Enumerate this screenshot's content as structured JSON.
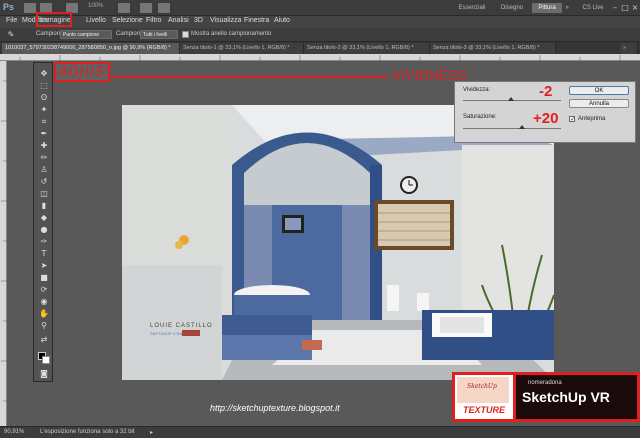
{
  "titlebar": {
    "zoom": "100%",
    "workspaces": [
      "Essenziali",
      "Disegno",
      "Pittura"
    ],
    "active_workspace": "Pittura",
    "cs_live": "CS Live"
  },
  "menu": {
    "items": [
      "File",
      "Modifica",
      "Immagine",
      "Livello",
      "Selezione",
      "Filtro",
      "Analisi",
      "3D",
      "Visualizza",
      "Finestra",
      "Aiuto"
    ]
  },
  "options": {
    "campione_label": "Campione:",
    "campione_value": "Punto campione",
    "campione2_label": "Campione:",
    "campione2_value": "Tutti i livelli",
    "ring_label": "Mostra anello campionamento"
  },
  "tabs": [
    "1010037_579730238749006_287580850_n.jpg @ 90,9% (RGB/8) *",
    "Senza titolo-1 @ 33,1% (Livello 1, RGB/8) *",
    "Senza titolo-2 @ 33,1% (Livello 1, RGB/8) *",
    "Senza titolo-3 @ 33,1% (Livello 1, RGB/8) *"
  ],
  "annotations": {
    "adjust": "ADJUST",
    "vividness": "VIVIDNESS"
  },
  "dialog": {
    "vividezza_label": "Vividezza:",
    "vividezza_value": "-2",
    "saturazione_label": "Saturazione:",
    "saturazione_value": "+20",
    "ok_label": "OK",
    "annulla_label": "Annulla",
    "anteprima_label": "Anteprima"
  },
  "photo": {
    "watermark_name": "LOUIE CASTILLO",
    "watermark_sub": "SKETCHUP V-RAY ARTIST"
  },
  "url": "http://sketchuptexture.blogspot.it",
  "status": {
    "zoom": "90,91%",
    "message": "L'esposizione funziona solo a 32 bit"
  },
  "logo": {
    "left_small": "SketchUp",
    "left_big": "TEXTURE",
    "right_small": "nomeradona",
    "right_big": "SketchUp VR"
  },
  "colors": {
    "accent_red": "#e02020"
  }
}
